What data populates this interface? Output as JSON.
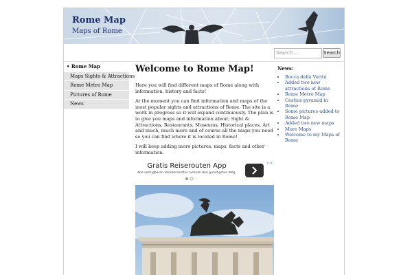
{
  "header": {
    "title": "Rome Map",
    "tagline": "Maps of Rome"
  },
  "search": {
    "placeholder": "Search …",
    "button_label": "Search"
  },
  "sidebar": {
    "items": [
      {
        "label": "Rome Map",
        "active": true
      },
      {
        "label": "Maps Sights & Attractions",
        "active": false
      },
      {
        "label": "Rome Metro Map",
        "active": false
      },
      {
        "label": "Pictures of Rome",
        "active": false
      },
      {
        "label": "News",
        "active": false
      }
    ]
  },
  "main": {
    "heading": "Welcome to Rome Map!",
    "paragraphs": [
      "Here you will find different maps of Rome along with information, history and facts!",
      "At the moment you can find information and maps of the most popular sights and attractions of Rome.  The site is a work in progress so it will expand continuously. The plan is to give you maps and information about; Sight & Attractions, Restaurants, Museums, Historical places, Art and much, much more and of course all the maps you need so you can find where it is located in Rome!",
      "I will keep adding more pictures,  maps, facts and other information."
    ]
  },
  "ad": {
    "title": "Gratis Reiserouten App",
    "subtitle": "Alle verfügbaren Verkehrsmittel. Schnell den günstigsten Weg",
    "arrow_icon": "chevron-right-icon"
  },
  "news": {
    "heading": "News:",
    "items": [
      "Bocca della Verità",
      "Added two new attractions of Rome",
      "Rome Metro Map",
      "Cestius pyramid in Rome",
      "Some pictures added to Rome Map",
      "Added two new maps",
      "More Maps",
      "Welcome to my Maps of Rome"
    ]
  },
  "colors": {
    "title": "#1d2f6b",
    "nav_bg": "#e4e4e4",
    "link": "#2c4c84",
    "sky": "#8fb6dd"
  }
}
